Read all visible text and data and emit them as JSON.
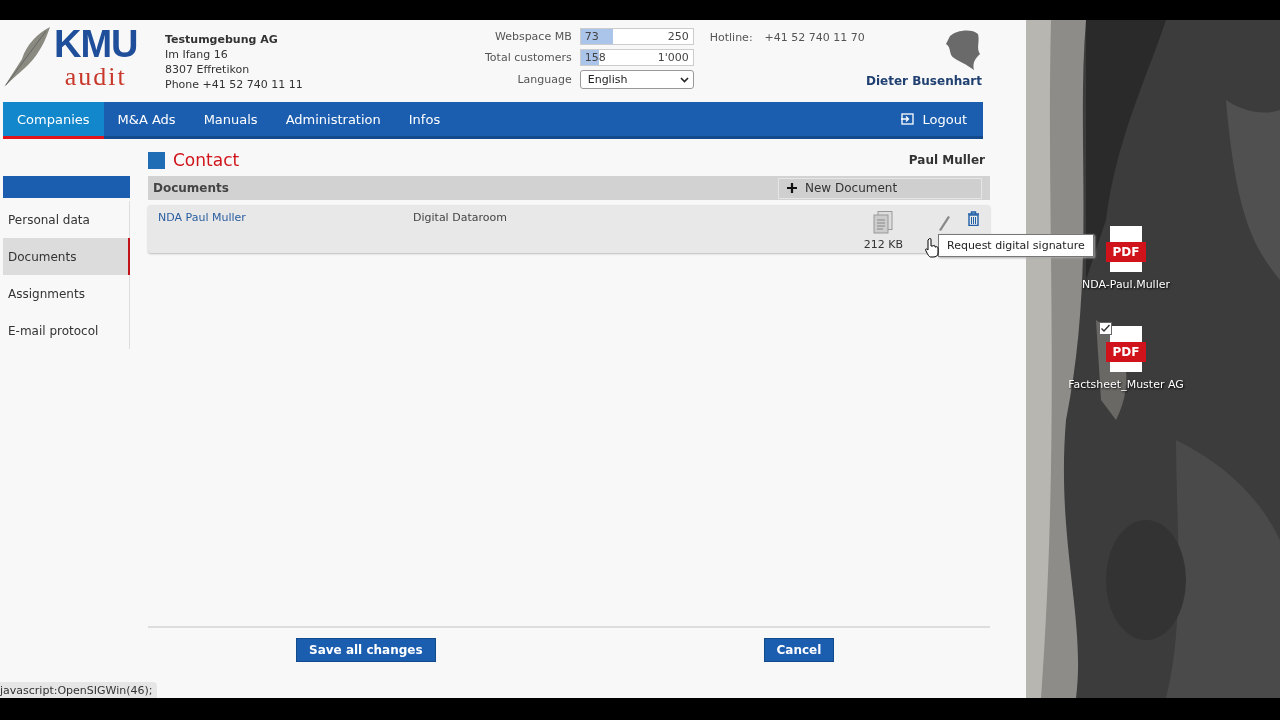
{
  "logo": {
    "line_1": "KMU",
    "line_2": "audit"
  },
  "company": {
    "name": "Testumgebung AG",
    "lines": [
      "Im Ifang 16",
      "8307 Effretikon",
      "Phone +41 52 740 11 11"
    ]
  },
  "meters": [
    {
      "label": "Webspace MB",
      "value": "73",
      "max": "250",
      "level": 0.29
    },
    {
      "label": "Total customers",
      "value": "158",
      "max": "1'000",
      "level": 0.16
    }
  ],
  "language": {
    "label": "Language",
    "value": "English"
  },
  "hotline": {
    "label": "Hotline:",
    "number": "+41 52 740 11 70"
  },
  "user": {
    "name": "Dieter Busenhart"
  },
  "nav": [
    {
      "label": "Companies",
      "selected": true
    },
    {
      "label": "M&A Ads",
      "selected": false
    },
    {
      "label": "Manuals",
      "selected": false
    },
    {
      "label": "Administration",
      "selected": false
    },
    {
      "label": "Infos",
      "selected": false
    }
  ],
  "logout": "Logout",
  "sidebar": [
    {
      "label": "Personal data",
      "selected": false
    },
    {
      "label": "Documents",
      "selected": true
    },
    {
      "label": "Assignments",
      "selected": false
    },
    {
      "label": "E-mail protocol",
      "selected": false
    }
  ],
  "page_title": "Contact",
  "contact_name": "Paul Muller",
  "documents": {
    "title": "Documents",
    "new_button": "New Document",
    "rows": [
      {
        "name": "NDA Paul Muller",
        "category": "Digital Dataroom",
        "size": "212 KB"
      }
    ]
  },
  "tooltip": "Request digital signature",
  "buttons": {
    "save": "Save all changes",
    "cancel": "Cancel"
  },
  "status_bar": "javascript:OpenSIGWin(46);",
  "desktop_icons": [
    {
      "label": "NDA-Paul.Muller",
      "file_type": "PDF",
      "checked": false
    },
    {
      "label": "Factsheet_Muster AG",
      "file_type": "PDF",
      "checked": true
    }
  ]
}
